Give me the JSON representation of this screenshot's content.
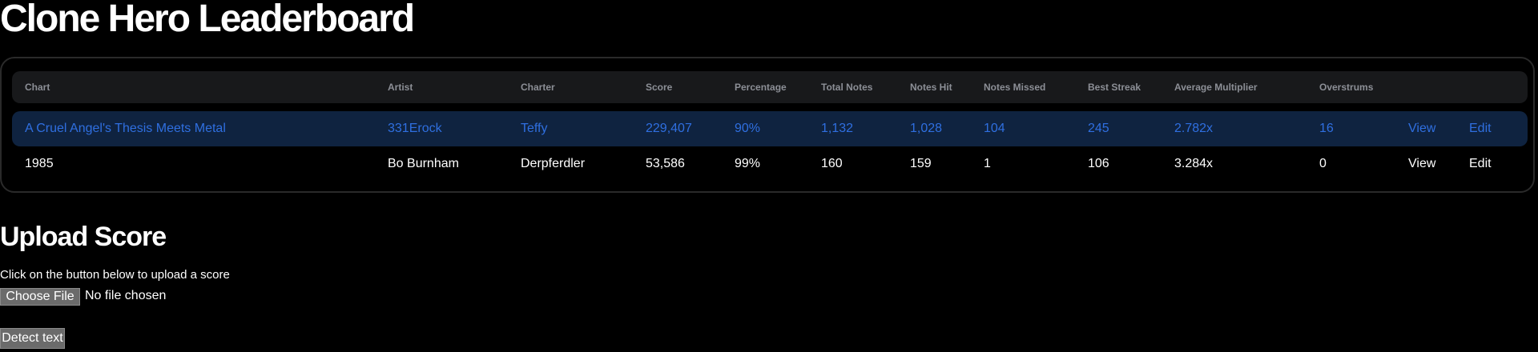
{
  "page": {
    "title": "Clone Hero Leaderboard"
  },
  "leaderboard": {
    "columns": [
      "Chart",
      "Artist",
      "Charter",
      "Score",
      "Percentage",
      "Total Notes",
      "Notes Hit",
      "Notes Missed",
      "Best Streak",
      "Average Multiplier",
      "Overstrums"
    ],
    "rows": [
      {
        "chart": "A Cruel Angel's Thesis Meets Metal",
        "artist": "331Erock",
        "charter": "Teffy",
        "score": "229,407",
        "percentage": "90%",
        "total_notes": "1,132",
        "notes_hit": "1,028",
        "notes_missed": "104",
        "best_streak": "245",
        "average_multiplier": "2.782x",
        "overstrums": "16",
        "view_label": "View",
        "edit_label": "Edit",
        "selected": true
      },
      {
        "chart": "1985",
        "artist": "Bo Burnham",
        "charter": "Derpferdler",
        "score": "53,586",
        "percentage": "99%",
        "total_notes": "160",
        "notes_hit": "159",
        "notes_missed": "1",
        "best_streak": "106",
        "average_multiplier": "3.284x",
        "overstrums": "0",
        "view_label": "View",
        "edit_label": "Edit",
        "selected": false
      }
    ]
  },
  "upload": {
    "heading": "Upload Score",
    "instructions": "Click on the button below to upload a score",
    "choose_file_label": "Choose File",
    "file_status": "No file chosen",
    "detect_button_label": "Detect text"
  },
  "colors": {
    "background": "#000000",
    "selected_row_background": "#0f2340",
    "selected_row_text": "#2f6fe0",
    "header_background": "#18191b",
    "header_text": "#8c8f96"
  }
}
